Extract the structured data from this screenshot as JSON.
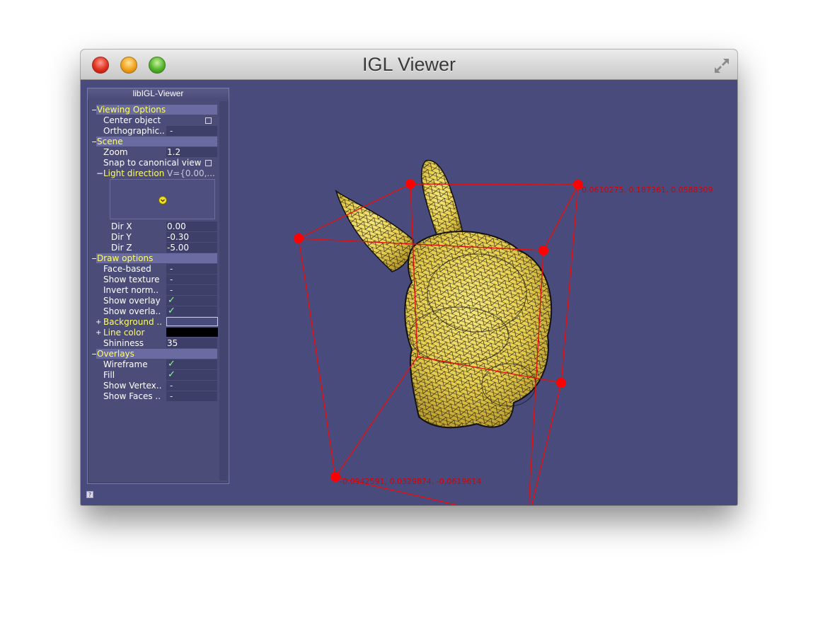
{
  "window": {
    "title": "IGL Viewer"
  },
  "panel": {
    "title": "libIGL-Viewer",
    "groups": {
      "viewing": {
        "label": "Viewing Options",
        "toggle": "−"
      },
      "scene": {
        "label": "Scene",
        "toggle": "−"
      },
      "draw": {
        "label": "Draw options",
        "toggle": "−"
      },
      "overlays": {
        "label": "Overlays",
        "toggle": "−"
      }
    },
    "rows": {
      "center_object": {
        "label": "Center object"
      },
      "orthographic": {
        "label": "Orthographic..",
        "value": "-"
      },
      "zoom": {
        "label": "Zoom",
        "value": "1.2"
      },
      "snap": {
        "label": "Snap to canonical view"
      },
      "light_direction": {
        "label": "Light direction",
        "toggle": "−",
        "value": "V={0.00,..."
      },
      "dir_x": {
        "label": "Dir X",
        "value": "0.00"
      },
      "dir_y": {
        "label": "Dir Y",
        "value": "-0.30"
      },
      "dir_z": {
        "label": "Dir Z",
        "value": "-5.00"
      },
      "face_based": {
        "label": "Face-based",
        "value": "-"
      },
      "show_texture": {
        "label": "Show texture",
        "value": "-"
      },
      "invert_normals": {
        "label": "Invert norm..",
        "value": "-"
      },
      "show_overlay": {
        "label": "Show overlay",
        "value": "✓"
      },
      "show_overlay_depth": {
        "label": "Show overla..",
        "value": "✓"
      },
      "background": {
        "label": "Background ..",
        "toggle": "+"
      },
      "line_color": {
        "label": "Line color",
        "toggle": "+"
      },
      "shininess": {
        "label": "Shininess",
        "value": "35"
      },
      "wireframe": {
        "label": "Wireframe",
        "value": "✓"
      },
      "fill": {
        "label": "Fill",
        "value": "✓"
      },
      "show_vertex": {
        "label": "Show Vertex..",
        "value": "-"
      },
      "show_faces": {
        "label": "Show Faces ..",
        "value": "-"
      }
    }
  },
  "scene": {
    "label_top": "0.0610275, 0.187361, 0.0588309",
    "label_bottom": "-0.0942591, 0.0329874, -0.0619614"
  },
  "colors": {
    "viewport_bg": "#4a4b7d",
    "bbox": "#ff0000",
    "mesh_fill": "#efd85a",
    "background_swatch": "#4a4b7d",
    "line_color_swatch": "#000000"
  }
}
